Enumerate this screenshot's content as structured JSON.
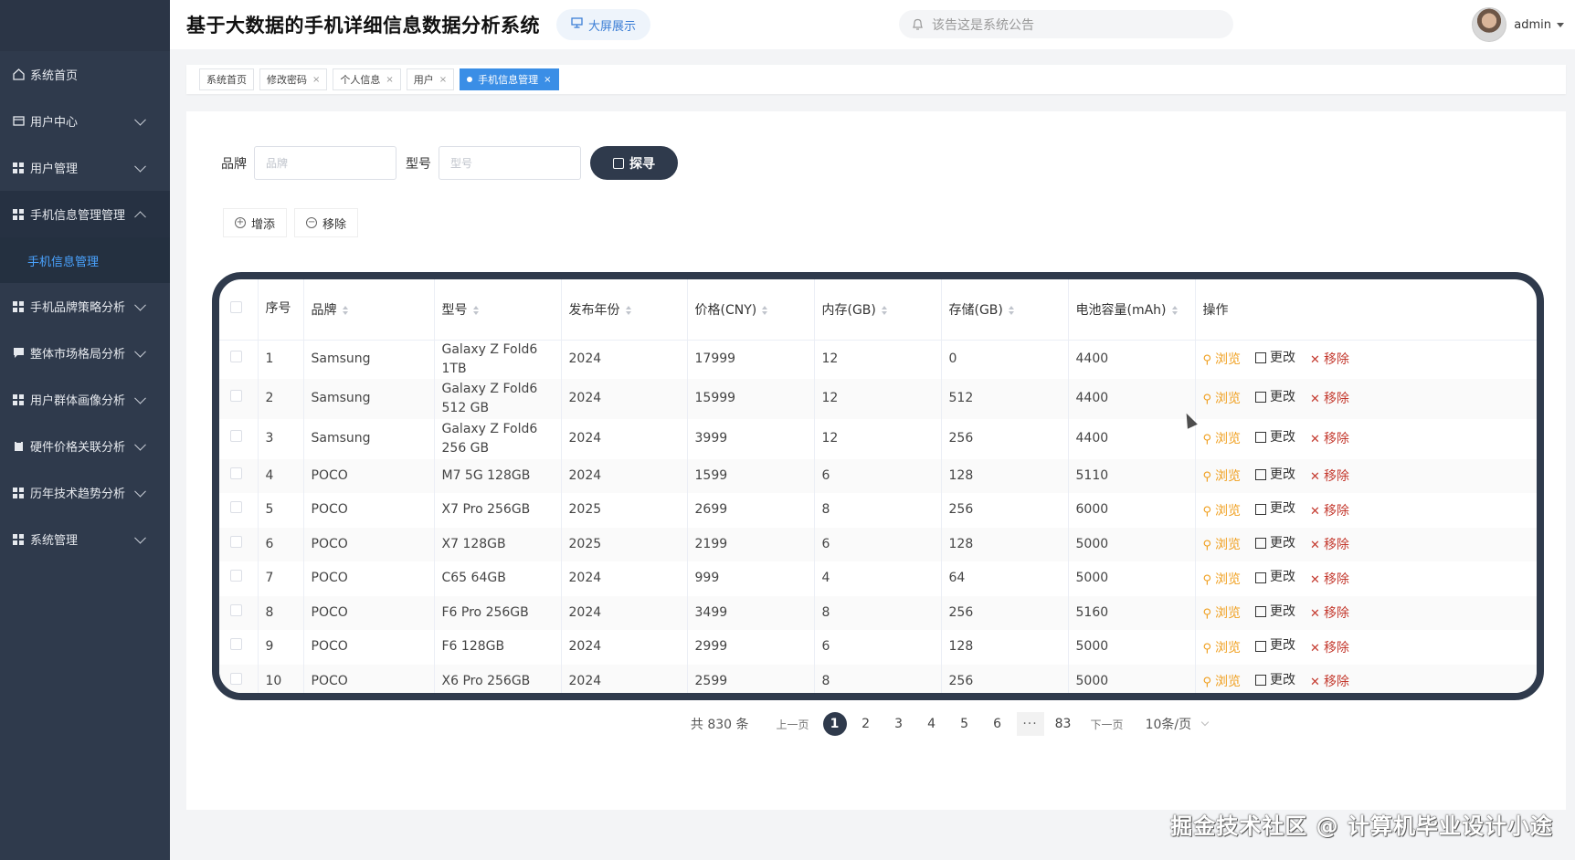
{
  "header": {
    "title": "基于大数据的手机详细信息数据分析系统",
    "bigscreen_label": "大屏展示",
    "notice_placeholder": "该告这是系统公告",
    "user_name": "admin"
  },
  "sidebar": {
    "items": [
      {
        "label": "系统首页",
        "icon": "home-icon"
      },
      {
        "label": "用户中心",
        "icon": "wallet-icon"
      },
      {
        "label": "用户管理",
        "icon": "grid-icon"
      },
      {
        "label": "手机信息管理管理",
        "icon": "grid-icon"
      },
      {
        "label": "手机品牌策略分析",
        "icon": "grid-icon"
      },
      {
        "label": "整体市场格局分析",
        "icon": "chat-icon"
      },
      {
        "label": "用户群体画像分析",
        "icon": "grid-icon"
      },
      {
        "label": "硬件价格关联分析",
        "icon": "clipboard-icon"
      },
      {
        "label": "历年技术趋势分析",
        "icon": "grid-icon"
      },
      {
        "label": "系统管理",
        "icon": "grid-icon"
      }
    ],
    "submenu_label": "手机信息管理"
  },
  "tabs": [
    {
      "label": "系统首页"
    },
    {
      "label": "修改密码"
    },
    {
      "label": "个人信息"
    },
    {
      "label": "用户"
    },
    {
      "label": "手机信息管理"
    }
  ],
  "search": {
    "brand_label": "品牌",
    "brand_placeholder": "品牌",
    "model_label": "型号",
    "model_placeholder": "型号",
    "button_label": "探寻"
  },
  "actions": {
    "add_label": "增添",
    "remove_label": "移除"
  },
  "table": {
    "headers": {
      "index": "序号",
      "brand": "品牌",
      "model": "型号",
      "year": "发布年份",
      "price": "价格(CNY)",
      "memory": "内存(GB)",
      "storage": "存储(GB)",
      "battery": "电池容量(mAh)",
      "ops": "操作"
    },
    "op_labels": {
      "view": "浏览",
      "edit": "更改",
      "delete": "移除"
    },
    "rows": [
      {
        "idx": "1",
        "brand": "Samsung",
        "model": "Galaxy Z Fold6 1TB",
        "year": "2024",
        "price": "17999",
        "memory": "12",
        "storage": "0",
        "battery": "4400"
      },
      {
        "idx": "2",
        "brand": "Samsung",
        "model": "Galaxy Z Fold6 512 GB",
        "year": "2024",
        "price": "15999",
        "memory": "12",
        "storage": "512",
        "battery": "4400"
      },
      {
        "idx": "3",
        "brand": "Samsung",
        "model": "Galaxy Z Fold6 256 GB",
        "year": "2024",
        "price": "3999",
        "memory": "12",
        "storage": "256",
        "battery": "4400"
      },
      {
        "idx": "4",
        "brand": "POCO",
        "model": "M7 5G 128GB",
        "year": "2024",
        "price": "1599",
        "memory": "6",
        "storage": "128",
        "battery": "5110"
      },
      {
        "idx": "5",
        "brand": "POCO",
        "model": "X7 Pro 256GB",
        "year": "2025",
        "price": "2699",
        "memory": "8",
        "storage": "256",
        "battery": "6000"
      },
      {
        "idx": "6",
        "brand": "POCO",
        "model": "X7 128GB",
        "year": "2025",
        "price": "2199",
        "memory": "6",
        "storage": "128",
        "battery": "5000"
      },
      {
        "idx": "7",
        "brand": "POCO",
        "model": "C65 64GB",
        "year": "2024",
        "price": "999",
        "memory": "4",
        "storage": "64",
        "battery": "5000"
      },
      {
        "idx": "8",
        "brand": "POCO",
        "model": "F6 Pro 256GB",
        "year": "2024",
        "price": "3499",
        "memory": "8",
        "storage": "256",
        "battery": "5160"
      },
      {
        "idx": "9",
        "brand": "POCO",
        "model": "F6 128GB",
        "year": "2024",
        "price": "2999",
        "memory": "6",
        "storage": "128",
        "battery": "5000"
      },
      {
        "idx": "10",
        "brand": "POCO",
        "model": "X6 Pro 256GB",
        "year": "2024",
        "price": "2599",
        "memory": "8",
        "storage": "256",
        "battery": "5000"
      }
    ]
  },
  "pagination": {
    "total": "共 830 条",
    "prev": "上一页",
    "pages": [
      "1",
      "2",
      "3",
      "4",
      "5",
      "6",
      "···",
      "83"
    ],
    "next": "下一页",
    "page_size": "10条/页"
  },
  "watermark": "掘金技术社区 @ 计算机毕业设计小途",
  "colors": {
    "sidebar_bg": "#2f3a4c",
    "accent": "#3a8ee6",
    "view_op": "#f0a020",
    "delete_op": "#c43a2f"
  }
}
